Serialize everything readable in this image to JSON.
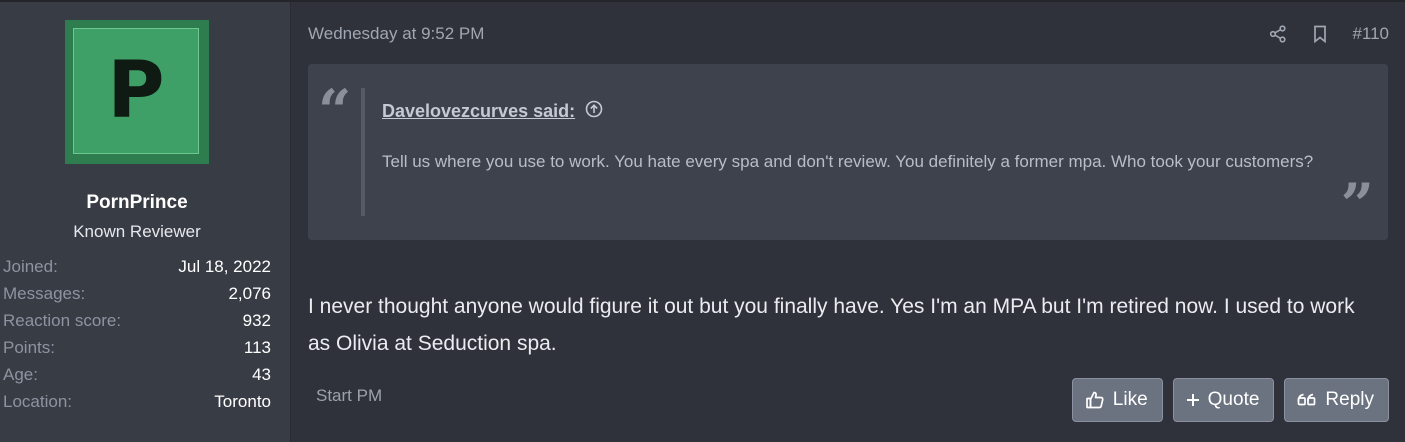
{
  "user": {
    "avatar_letter": "P",
    "username": "PornPrince",
    "title": "Known Reviewer",
    "stats": [
      {
        "label": "Joined:",
        "value": "Jul 18, 2022"
      },
      {
        "label": "Messages:",
        "value": "2,076"
      },
      {
        "label": "Reaction score:",
        "value": "932"
      },
      {
        "label": "Points:",
        "value": "113"
      },
      {
        "label": "Age:",
        "value": "43"
      },
      {
        "label": "Location:",
        "value": "Toronto"
      }
    ]
  },
  "post": {
    "date": "Wednesday at 9:52 PM",
    "number": "#110",
    "quote": {
      "author": "Davelovezcurves said:",
      "text": "Tell us where you use to work. You hate every spa and don't review. You definitely a former mpa. Who took your customers?"
    },
    "body": "I never thought anyone would figure it out but you finally have. Yes I'm an MPA but I'm retired now. I used to work as Olivia at Seduction spa.",
    "start_pm": "Start PM",
    "actions": {
      "like": "Like",
      "quote": "Quote",
      "reply": "Reply"
    }
  },
  "icons": {
    "share": "share-icon",
    "bookmark": "bookmark-icon",
    "quote_open": "quote-open-icon",
    "quote_close": "quote-close-icon",
    "jump": "arrow-up-circle-icon",
    "like": "thumbs-up-icon",
    "add": "plus-icon",
    "reply": "quote-reply-icon"
  },
  "colors": {
    "avatar_bg": "#3ea067",
    "button_bg": "#6b7280",
    "page_bg": "#2f323a",
    "sidebar_bg": "#383c45"
  }
}
